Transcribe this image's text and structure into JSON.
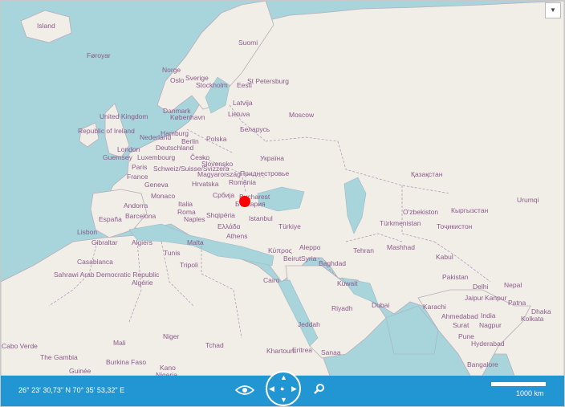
{
  "map": {
    "labels": [
      "Island",
      "Føroyar",
      "Norge",
      "Sverige",
      "Oslo",
      "Stockholm",
      "Suomi",
      "Eesti",
      "St Petersburg",
      "Latvija",
      "Lietuva",
      "Moscow",
      "Danmark",
      "København",
      "United Kingdom",
      "Republic of Ireland",
      "Nederland",
      "Hamburg",
      "Berlin",
      "Polska",
      "Беларусь",
      "London",
      "Deutschland",
      "Guernsey",
      "Luxembourg",
      "Česko",
      "Slovensko",
      "Paris",
      "France",
      "Schweiz/Suisse/Svizzera",
      "Geneva",
      "Magyarország",
      "Hrvatska",
      "România",
      "Україна",
      "Приднестровье",
      "Қазақстан",
      "Monaco",
      "Andorra",
      "Italia",
      "Србија",
      "Bucharest",
      "България",
      "Urumqi",
      "Roma",
      "Naples",
      "Shqipëria",
      "Istanbul",
      "Ελλάδα",
      "Athens",
      "Türkiye",
      "España",
      "Barcelona",
      "Lisbon",
      "Gibraltar",
      "Algiers",
      "Malta",
      "Casablanca",
      "Tunis",
      "Tripoli",
      "Κύπρος",
      "Beirut",
      "Aleppo",
      "Syria",
      "Baghdad",
      "Tehran",
      "Mashhad",
      "Kabul",
      "Pakistan",
      "Türkmenistan",
      "O'zbekiston",
      "Кыргызстан",
      "Тоҷикистон",
      "Delhi",
      "Nepal",
      "Jaipur",
      "Kanpur",
      "Patna",
      "Dhaka",
      "Karachi",
      "Ahmedabad",
      "India",
      "Nagpur",
      "Kolkata",
      "Surat",
      "Pune",
      "Hyderabad",
      "Bangalore",
      "Cairo",
      "Riyadh",
      "Dubai",
      "Jeddah",
      "Sanaa",
      "Kuwait",
      "Algérie",
      "Mali",
      "Niger",
      "Tchad",
      "Burkina Faso",
      "Guinée",
      "Kano",
      "Nigeria",
      "The Gambia",
      "Cabo Verde",
      "Khartoum",
      "Eritrea",
      "Sahrawi Arab Democratic Republic"
    ]
  },
  "marker": {
    "color": "#ff0000",
    "name": "location-marker"
  },
  "controls": {
    "dropdown_icon": "chevron-down-icon",
    "coordinates": "26° 23' 30,73\" N 70° 35' 53,32\" E",
    "eye_icon": "eye-icon",
    "pan_icon": "pan-navigator-icon",
    "search_icon": "search-icon",
    "scale_label": "1000 km"
  },
  "colors": {
    "water": "#a8d4dc",
    "land": "#f1eee8",
    "toolbar": "#2196d3",
    "label": "#8a5a8a"
  }
}
